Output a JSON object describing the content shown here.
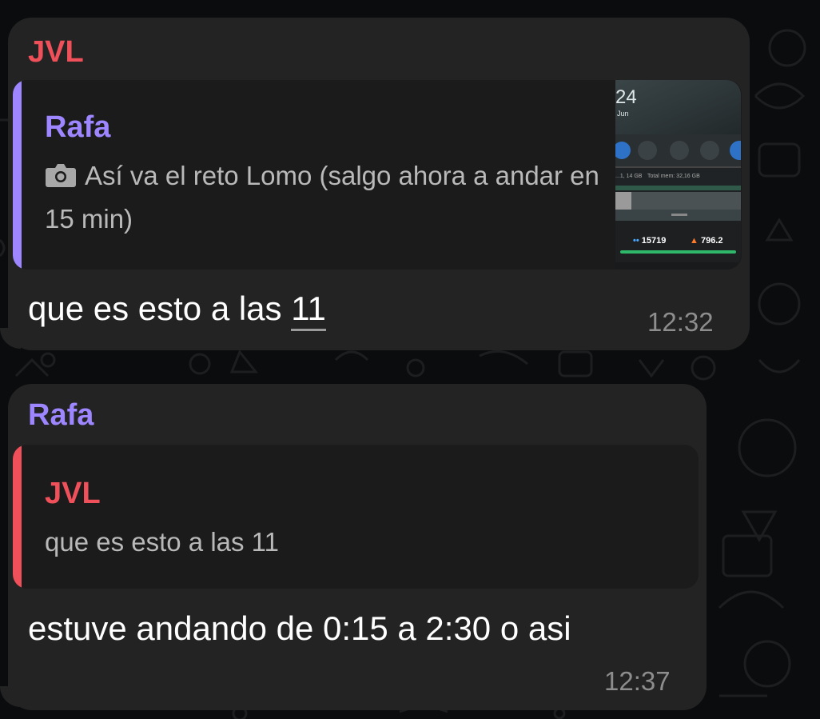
{
  "messages": [
    {
      "sender": "JVL",
      "sender_color": "#f0505a",
      "reply_to": {
        "name": "Rafa",
        "name_color": "#9d86ff",
        "text": "Así va el reto Lomo (salgo ahora a andar en 15 min)",
        "icon": "camera-icon",
        "thumbnail": {
          "clock": "24",
          "date": "Jun",
          "storage_text_1": "...1, 14 GB",
          "storage_text_2": "Total mem: 32,16 GB",
          "steps": "15719",
          "calories": "796.2"
        }
      },
      "text": "que es esto a las",
      "text_number": "11",
      "time": "12:32"
    },
    {
      "sender": "Rafa",
      "sender_color": "#9d86ff",
      "reply_to": {
        "name": "JVL",
        "name_color": "#f0505a",
        "text": "que es esto a las 11"
      },
      "text": "estuve andando de 0:15 a 2:30 o asi",
      "time": "12:37"
    }
  ]
}
